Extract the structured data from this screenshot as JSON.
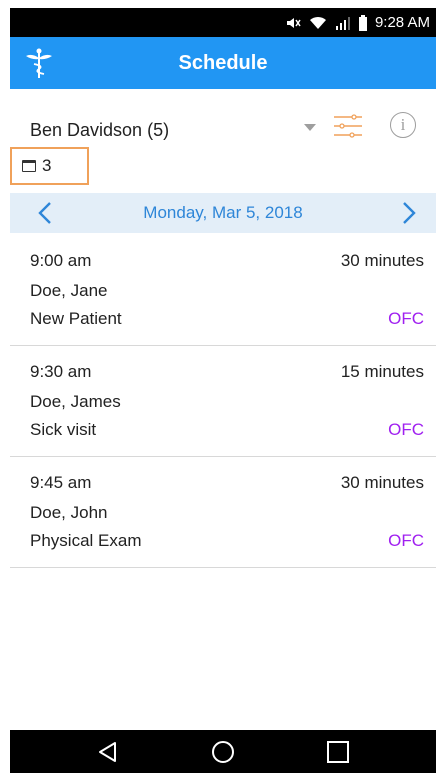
{
  "status_bar": {
    "time": "9:28 AM",
    "icons": [
      "mute-icon",
      "wifi-icon",
      "signal-icon",
      "battery-icon"
    ]
  },
  "app_bar": {
    "title": "Schedule",
    "logo_icon": "caduceus-icon",
    "color": "#2196F3"
  },
  "provider": {
    "name": "Ben Davidson (5)",
    "dropdown_icon": "caret-down-icon",
    "filter_icon": "filter-sliders-icon",
    "info_icon": "info-icon",
    "info_glyph": "i"
  },
  "calendar_badge": {
    "icon": "calendar-icon",
    "count": "3"
  },
  "date_nav": {
    "date": "Monday, Mar 5, 2018",
    "prev_icon": "chevron-left-icon",
    "next_icon": "chevron-right-icon"
  },
  "appointments": [
    {
      "time": "9:00 am",
      "duration": "30 minutes",
      "patient": "Doe, Jane",
      "type": "New Patient",
      "location": "OFC"
    },
    {
      "time": "9:30 am",
      "duration": "15 minutes",
      "patient": "Doe, James",
      "type": "Sick visit",
      "location": "OFC"
    },
    {
      "time": "9:45 am",
      "duration": "30 minutes",
      "patient": "Doe, John",
      "type": "Physical Exam",
      "location": "OFC"
    }
  ],
  "nav_bar": {
    "icons": [
      "back-icon",
      "home-icon",
      "recents-icon"
    ]
  },
  "colors": {
    "accent": "#2196F3",
    "location": "#A020F0",
    "highlight": "#F0A15A"
  }
}
